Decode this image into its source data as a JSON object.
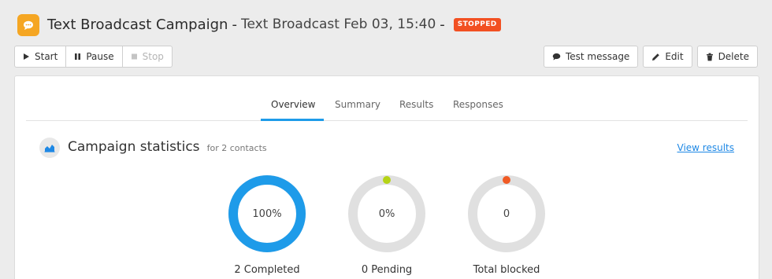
{
  "header": {
    "icon": "chat-bubble-icon",
    "title": "Text Broadcast Campaign",
    "separator": "-",
    "subtitle": "Text Broadcast Feb 03, 15:40",
    "separator2": "-",
    "status": "STOPPED",
    "colors": {
      "app_icon": "#f5a623",
      "status_badge": "#f25022"
    }
  },
  "toolbar": {
    "left": [
      {
        "label": "Start",
        "icon": "play-icon"
      },
      {
        "label": "Pause",
        "icon": "pause-icon"
      },
      {
        "label": "Stop",
        "icon": "stop-icon",
        "disabled": true
      }
    ],
    "right": [
      {
        "label": "Test message",
        "icon": "chat-bubble-icon"
      },
      {
        "label": "Edit",
        "icon": "pencil-icon"
      },
      {
        "label": "Delete",
        "icon": "trash-icon"
      }
    ]
  },
  "tabs": [
    {
      "label": "Overview",
      "active": true
    },
    {
      "label": "Summary"
    },
    {
      "label": "Results"
    },
    {
      "label": "Responses"
    }
  ],
  "stats": {
    "icon": "area-chart-icon",
    "title": "Campaign statistics",
    "subtitle": "for 2 contacts",
    "link": "View results",
    "donuts": [
      {
        "value": "100%",
        "label": "2 Completed",
        "fraction": 1.0,
        "color": "#1e9be9",
        "dot": null
      },
      {
        "value": "0%",
        "label": "0 Pending",
        "fraction": 0,
        "color": "#e0e0e0",
        "dot": "#b5d316"
      },
      {
        "value": "0",
        "label": "Total blocked",
        "fraction": 0,
        "color": "#e0e0e0",
        "dot": "#f05a24"
      }
    ]
  }
}
